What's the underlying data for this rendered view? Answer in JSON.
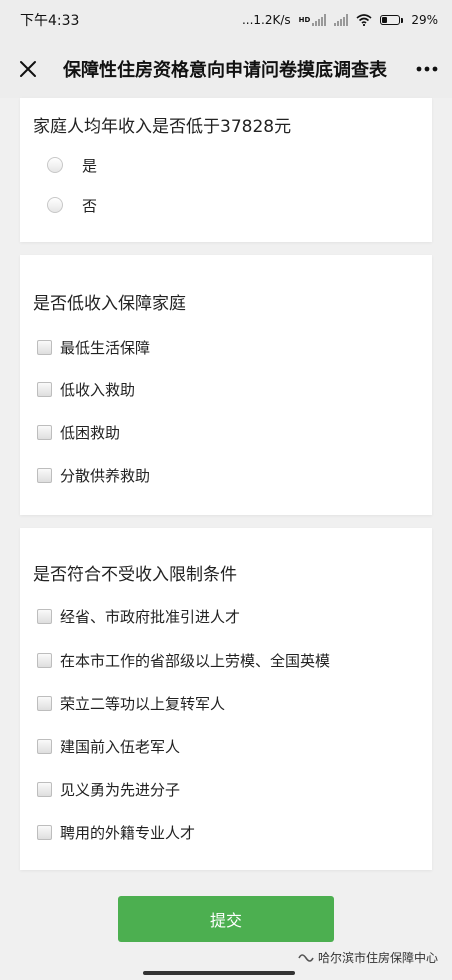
{
  "status_bar": {
    "time": "下午4:33",
    "network_speed": "...1.2K/s",
    "hd_label": "HD",
    "battery": "29%"
  },
  "nav": {
    "title": "保障性住房资格意向申请问卷摸底调查表",
    "close_icon": "close-icon",
    "more_icon": "more-icon"
  },
  "questions": [
    {
      "title": "家庭人均年收入是否低于37828元",
      "type": "radio",
      "options": [
        "是",
        "否"
      ]
    },
    {
      "title": "是否低收入保障家庭",
      "type": "checkbox",
      "options": [
        "最低生活保障",
        "低收入救助",
        "低困救助",
        "分散供养救助"
      ]
    },
    {
      "title": "是否符合不受收入限制条件",
      "type": "checkbox",
      "options": [
        "经省、市政府批准引进人才",
        "在本市工作的省部级以上劳模、全国英模",
        "荣立二等功以上复转军人",
        "建国前入伍老军人",
        "见义勇为先进分子",
        "聘用的外籍专业人才"
      ]
    }
  ],
  "submit_label": "提交",
  "watermark": "哈尔滨市住房保障中心",
  "colors": {
    "submit": "#4caf50",
    "background": "#f0f0f0",
    "card": "#ffffff"
  }
}
